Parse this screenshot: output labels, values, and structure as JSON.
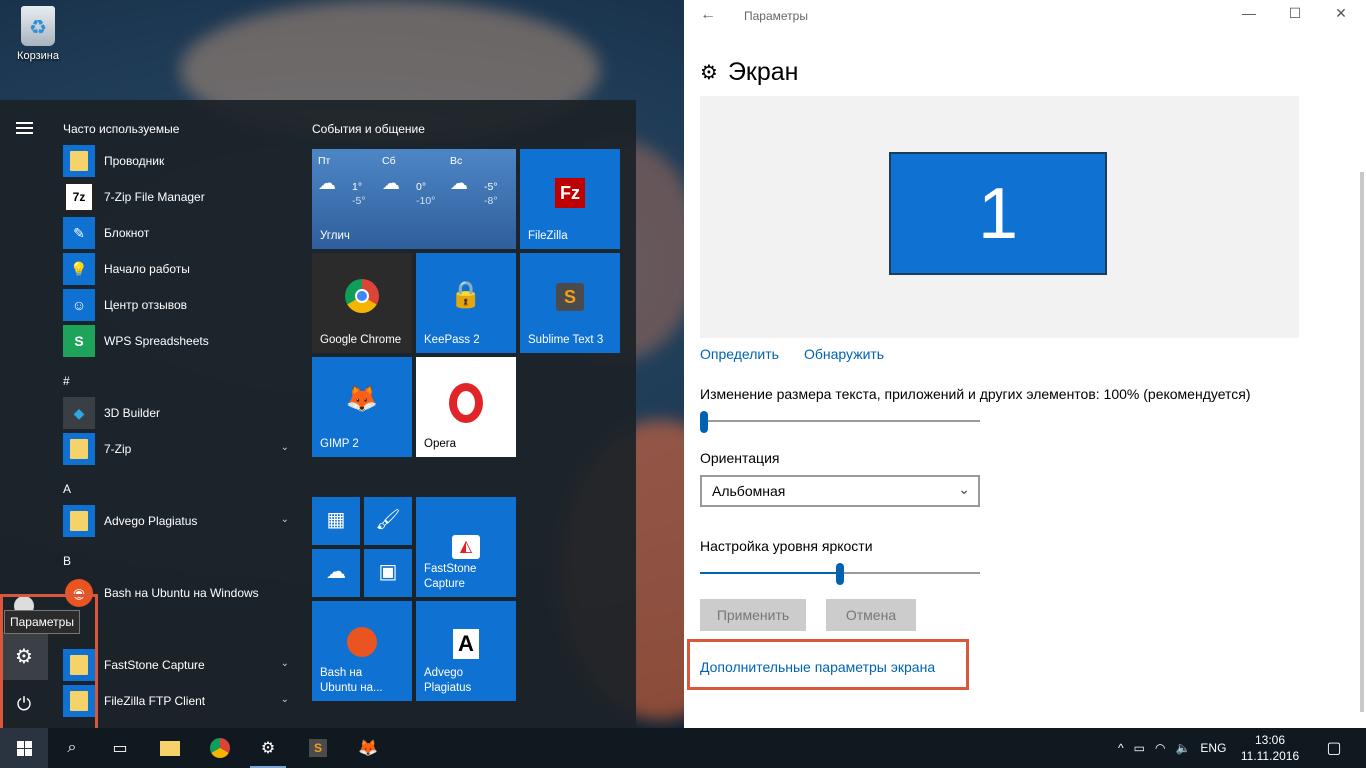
{
  "desktop": {
    "recycle_bin_label": "Корзина"
  },
  "start_menu": {
    "tooltip": "Параметры",
    "most_used_header": "Часто используемые",
    "most_used": [
      {
        "label": "Проводник",
        "icon": "folder-icon"
      },
      {
        "label": "7-Zip File Manager",
        "icon": "7z-icon",
        "glyph": "7z"
      },
      {
        "label": "Блокнот",
        "icon": "notepad-icon",
        "glyph": "✎"
      },
      {
        "label": "Начало работы",
        "icon": "lightbulb-icon",
        "glyph": "💡"
      },
      {
        "label": "Центр отзывов",
        "icon": "feedback-icon",
        "glyph": "☺"
      },
      {
        "label": "WPS Spreadsheets",
        "icon": "wps-icon",
        "glyph": "S"
      }
    ],
    "hash_header": "#",
    "hash_apps": [
      {
        "label": "3D Builder",
        "icon": "3d-builder-icon",
        "glyph": "◆"
      },
      {
        "label": "7-Zip",
        "icon": "folder-icon"
      }
    ],
    "a_header": "A",
    "a_apps": [
      {
        "label": "Advego Plagiatus",
        "icon": "folder-icon"
      }
    ],
    "b_header": "B",
    "b_apps": [
      {
        "label": "Bash на Ubuntu на Windows",
        "icon": "ubuntu-icon",
        "glyph": "◉"
      }
    ],
    "f_apps": [
      {
        "label": "FastStone Capture",
        "icon": "folder-icon"
      },
      {
        "label": "FileZilla FTP Client",
        "icon": "folder-icon"
      }
    ],
    "tile_group": "События и общение",
    "weather": {
      "city": "Углич",
      "days": [
        {
          "day": "Пт",
          "hi": "1°",
          "lo": "-5°",
          "icon": "rain-cloud-icon"
        },
        {
          "day": "Сб",
          "hi": "0°",
          "lo": "-10°",
          "icon": "snow-cloud-icon"
        },
        {
          "day": "Вс",
          "hi": "-5°",
          "lo": "-8°",
          "icon": "cloud-icon"
        }
      ]
    },
    "tiles": {
      "filezilla": "FileZilla",
      "chrome": "Google Chrome",
      "keepass": "KeePass 2",
      "sublime": "Sublime Text 3",
      "gimp": "GIMP 2",
      "opera": "Opera",
      "faststone": "FastStone Capture",
      "bash": "Bash на Ubuntu на...",
      "advego": "Advego Plagiatus"
    }
  },
  "settings": {
    "window_title": "Параметры",
    "page_title": "Экран",
    "monitor_number": "1",
    "identify_link": "Определить",
    "detect_link": "Обнаружить",
    "scale_label": "Изменение размера текста, приложений и других элементов: 100% (рекомендуется)",
    "scale_value": 0,
    "orientation_label": "Ориентация",
    "orientation_value": "Альбомная",
    "brightness_label": "Настройка уровня яркости",
    "brightness_value": 0.5,
    "apply_button": "Применить",
    "cancel_button": "Отмена",
    "advanced_link": "Дополнительные параметры экрана"
  },
  "taskbar": {
    "language": "ENG",
    "time": "13:06",
    "date": "11.11.2016"
  }
}
